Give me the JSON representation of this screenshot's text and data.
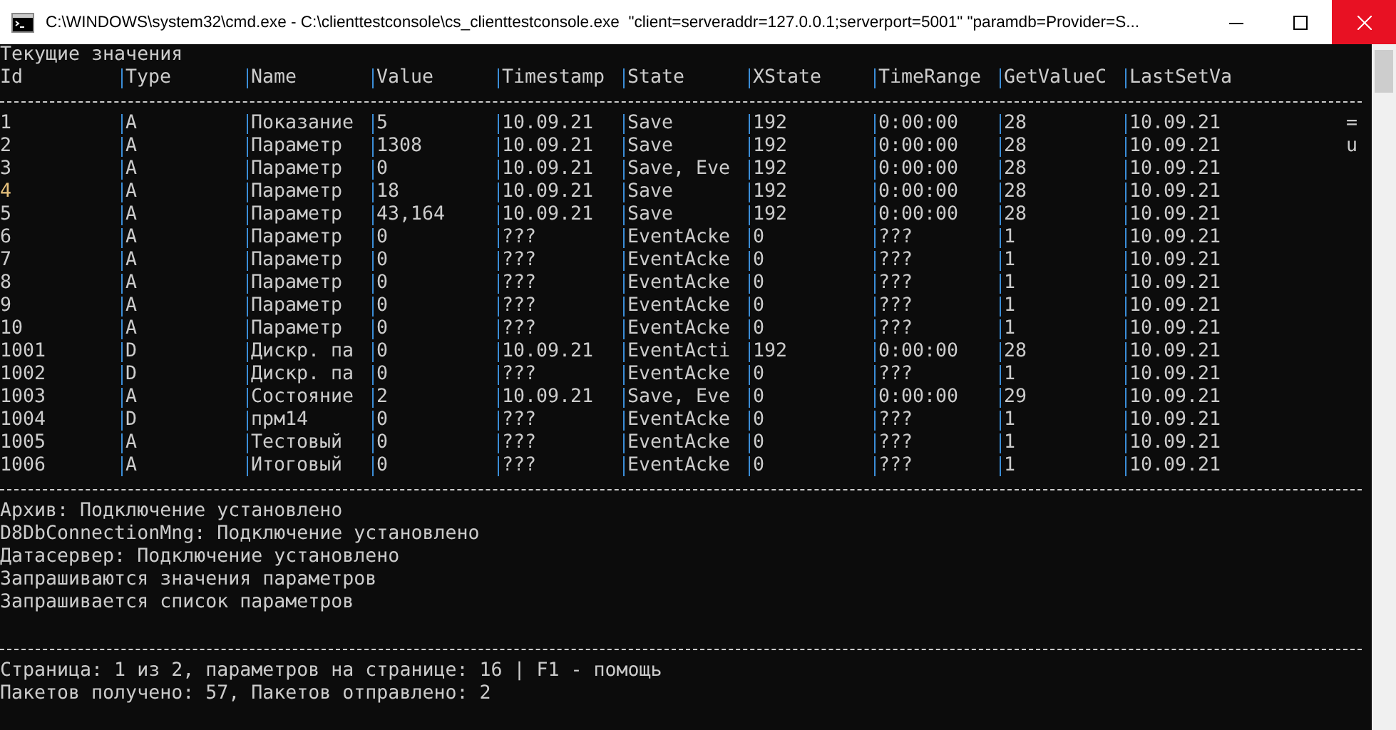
{
  "window": {
    "title": "C:\\WINDOWS\\system32\\cmd.exe - C:\\clienttestconsole\\cs_clienttestconsole.exe  \"client=serveraddr=127.0.0.1;serverport=5001\" \"paramdb=Provider=S..."
  },
  "heading": "Текущие значения",
  "table": {
    "columns": [
      "Id",
      "Type",
      "Name",
      "Value",
      "Timestamp",
      "State",
      "XState",
      "TimeRange",
      "GetValueC",
      "LastSetVa"
    ],
    "rows": [
      {
        "highlighted": false,
        "cells": [
          "1",
          "A",
          "Показание",
          "5",
          "10.09.21",
          "Save",
          "192",
          "0:00:00",
          "28",
          "10.09.21"
        ],
        "overflow": "="
      },
      {
        "highlighted": false,
        "cells": [
          "2",
          "A",
          "Параметр",
          "1308",
          "10.09.21",
          "Save",
          "192",
          "0:00:00",
          "28",
          "10.09.21"
        ],
        "overflow": "u"
      },
      {
        "highlighted": false,
        "cells": [
          "3",
          "A",
          "Параметр",
          "0",
          "10.09.21",
          "Save, Eve",
          "192",
          "0:00:00",
          "28",
          "10.09.21"
        ]
      },
      {
        "highlighted": true,
        "cells": [
          "4",
          "A",
          "Параметр",
          "18",
          "10.09.21",
          "Save",
          "192",
          "0:00:00",
          "28",
          "10.09.21"
        ]
      },
      {
        "highlighted": false,
        "cells": [
          "5",
          "A",
          "Параметр",
          "43,164",
          "10.09.21",
          "Save",
          "192",
          "0:00:00",
          "28",
          "10.09.21"
        ]
      },
      {
        "highlighted": false,
        "cells": [
          "6",
          "A",
          "Параметр",
          "0",
          "???",
          "EventAcke",
          "0",
          "???",
          "1",
          "10.09.21"
        ]
      },
      {
        "highlighted": false,
        "cells": [
          "7",
          "A",
          "Параметр",
          "0",
          "???",
          "EventAcke",
          "0",
          "???",
          "1",
          "10.09.21"
        ]
      },
      {
        "highlighted": false,
        "cells": [
          "8",
          "A",
          "Параметр",
          "0",
          "???",
          "EventAcke",
          "0",
          "???",
          "1",
          "10.09.21"
        ]
      },
      {
        "highlighted": false,
        "cells": [
          "9",
          "A",
          "Параметр",
          "0",
          "???",
          "EventAcke",
          "0",
          "???",
          "1",
          "10.09.21"
        ]
      },
      {
        "highlighted": false,
        "cells": [
          "10",
          "A",
          "Параметр",
          "0",
          "???",
          "EventAcke",
          "0",
          "???",
          "1",
          "10.09.21"
        ]
      },
      {
        "highlighted": false,
        "cells": [
          "1001",
          "D",
          "Дискр. па",
          "0",
          "10.09.21",
          "EventActi",
          "192",
          "0:00:00",
          "28",
          "10.09.21"
        ]
      },
      {
        "highlighted": false,
        "cells": [
          "1002",
          "D",
          "Дискр. па",
          "0",
          "???",
          "EventAcke",
          "0",
          "???",
          "1",
          "10.09.21"
        ]
      },
      {
        "highlighted": false,
        "cells": [
          "1003",
          "A",
          "Состояние",
          "2",
          "10.09.21",
          "Save, Eve",
          "0",
          "0:00:00",
          "29",
          "10.09.21"
        ]
      },
      {
        "highlighted": false,
        "cells": [
          "1004",
          "D",
          "прм14",
          "0",
          "???",
          "EventAcke",
          "0",
          "???",
          "1",
          "10.09.21"
        ]
      },
      {
        "highlighted": false,
        "cells": [
          "1005",
          "A",
          "Тестовый",
          "0",
          "???",
          "EventAcke",
          "0",
          "???",
          "1",
          "10.09.21"
        ]
      },
      {
        "highlighted": false,
        "cells": [
          "1006",
          "A",
          "Итоговый",
          "0",
          "???",
          "EventAcke",
          "0",
          "???",
          "1",
          "10.09.21"
        ]
      }
    ]
  },
  "messages": [
    "Архив: Подключение установлено",
    "D8DbConnectionMng: Подключение установлено",
    "Датасервер: Подключение установлено",
    "Запрашиваются значения параметров",
    "Запрашивается список параметров"
  ],
  "footer": [
    "Страница: 1 из 2, параметров на странице: 16 | F1 - помощь",
    "Пакетов получено: 57, Пакетов отправлено: 2"
  ]
}
